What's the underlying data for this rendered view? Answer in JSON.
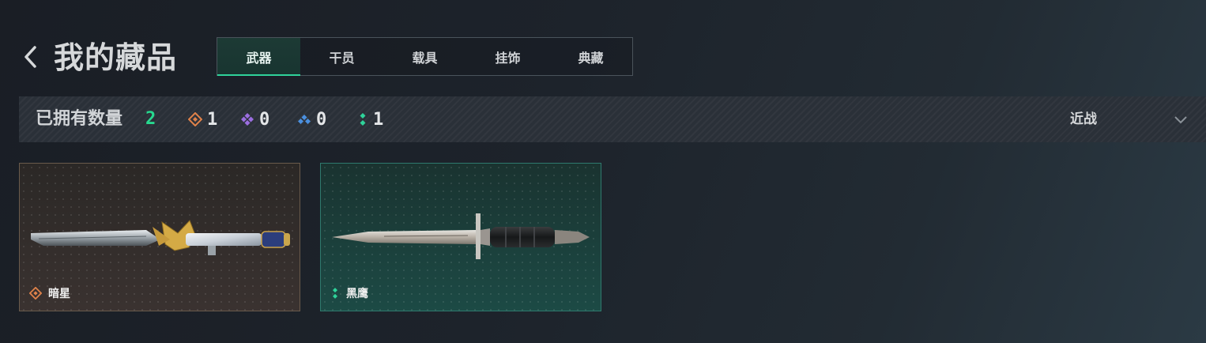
{
  "header": {
    "back_icon": "chevron-left-icon",
    "title": "我的藏品",
    "tabs": [
      {
        "label": "武器",
        "active": true
      },
      {
        "label": "干员",
        "active": false
      },
      {
        "label": "载具",
        "active": false
      },
      {
        "label": "挂饰",
        "active": false
      },
      {
        "label": "典藏",
        "active": false
      }
    ]
  },
  "summary": {
    "owned_label": "已拥有数量",
    "owned_total": "2",
    "rarity_counts": [
      {
        "icon": "orange-rarity-icon",
        "color": "#e0824a",
        "count": "1"
      },
      {
        "icon": "purple-rarity-icon",
        "color": "#9b6ee0",
        "count": "0"
      },
      {
        "icon": "blue-rarity-icon",
        "color": "#4a90e0",
        "count": "0"
      },
      {
        "icon": "green-rarity-icon",
        "color": "#2fd39a",
        "count": "1"
      }
    ],
    "filter": {
      "selected": "近战",
      "icon": "chevron-down-icon"
    }
  },
  "items": [
    {
      "name": "暗星",
      "rarity_icon": "orange-rarity-icon",
      "rarity_color": "#e0824a",
      "image": "ornate-knife"
    },
    {
      "name": "黑鹰",
      "rarity_icon": "green-rarity-icon",
      "rarity_color": "#2fd39a",
      "image": "combat-knife"
    }
  ],
  "colors": {
    "accent": "#2fd39a",
    "owned_total": "#27d98f"
  }
}
